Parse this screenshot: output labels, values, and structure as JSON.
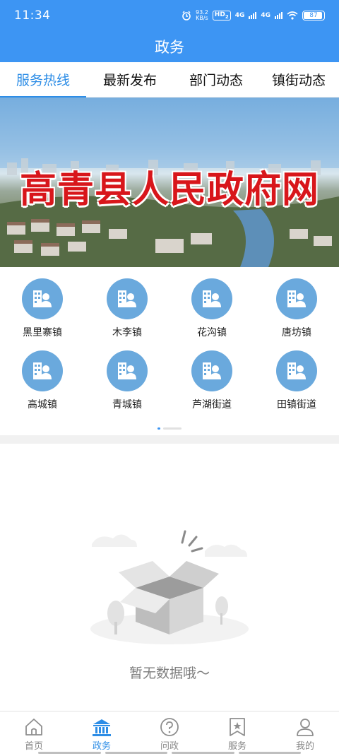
{
  "status_bar": {
    "time": "11:34",
    "net_speed_value": "93.2",
    "net_speed_unit": "KB/s",
    "hd_label": "HD",
    "hd_sub": "2",
    "sig1_label": "4G",
    "sig2_label": "4G",
    "battery": "87"
  },
  "header": {
    "title": "政务"
  },
  "tabs": [
    {
      "label": "服务热线",
      "active": true
    },
    {
      "label": "最新发布",
      "active": false
    },
    {
      "label": "部门动态",
      "active": false
    },
    {
      "label": "镇街动态",
      "active": false
    }
  ],
  "banner": {
    "title": "高青县人民政府网"
  },
  "towns": [
    {
      "label": "黑里寨镇",
      "icon": "person-card-icon"
    },
    {
      "label": "木李镇",
      "icon": "person-card-icon"
    },
    {
      "label": "花沟镇",
      "icon": "person-card-icon"
    },
    {
      "label": "唐坊镇",
      "icon": "person-card-icon"
    },
    {
      "label": "高城镇",
      "icon": "person-card-icon"
    },
    {
      "label": "青城镇",
      "icon": "person-card-icon"
    },
    {
      "label": "芦湖街道",
      "icon": "person-card-icon"
    },
    {
      "label": "田镇街道",
      "icon": "person-card-icon"
    }
  ],
  "empty_state": {
    "text": "暂无数据哦～"
  },
  "bottom_nav": [
    {
      "label": "首页",
      "icon": "home-icon",
      "active": false
    },
    {
      "label": "政务",
      "icon": "government-building-icon",
      "active": true
    },
    {
      "label": "问政",
      "icon": "question-icon",
      "active": false
    },
    {
      "label": "服务",
      "icon": "bookmark-star-icon",
      "active": false
    },
    {
      "label": "我的",
      "icon": "user-icon",
      "active": false
    }
  ],
  "colors": {
    "primary": "#3d95f3",
    "active_tab": "#2d8de6",
    "icon_circle": "#6aa9dd",
    "banner_title": "#d8161b"
  }
}
